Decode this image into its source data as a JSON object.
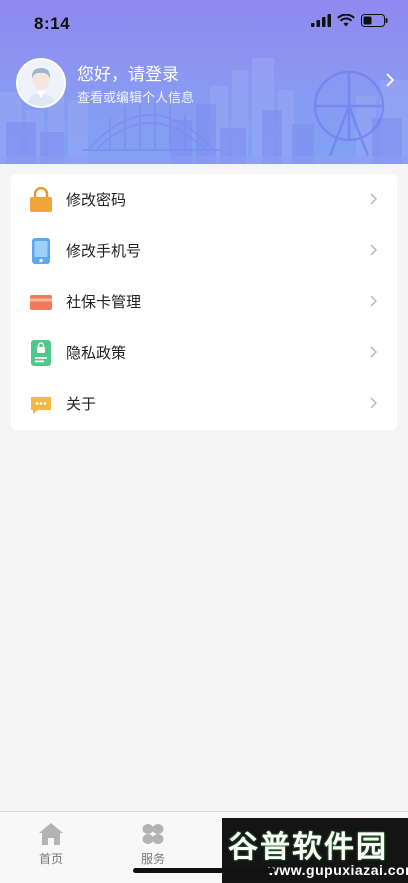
{
  "status_bar": {
    "time": "8:14"
  },
  "profile": {
    "title": "您好，请登录",
    "subtitle": "查看或编辑个人信息"
  },
  "menu": {
    "items": [
      {
        "label": "修改密码",
        "icon": "lock-icon",
        "color": "#f0a43a"
      },
      {
        "label": "修改手机号",
        "icon": "phone-icon",
        "color": "#5aa9f0"
      },
      {
        "label": "社保卡管理",
        "icon": "card-icon",
        "color": "#ef7b5a"
      },
      {
        "label": "隐私政策",
        "icon": "privacy-icon",
        "color": "#4ec98b"
      },
      {
        "label": "关于",
        "icon": "chat-icon",
        "color": "#f3b744"
      }
    ]
  },
  "tabbar": {
    "tabs": [
      {
        "label": "首页",
        "icon": "home-icon"
      },
      {
        "label": "服务",
        "icon": "services-icon"
      }
    ]
  },
  "watermark": {
    "main": "谷普软件园",
    "sub": "www.gupuxiazai.com"
  },
  "colors": {
    "header_start": "#8f88f0",
    "header_end": "#7fa3f3",
    "background": "#f5f5f5"
  }
}
